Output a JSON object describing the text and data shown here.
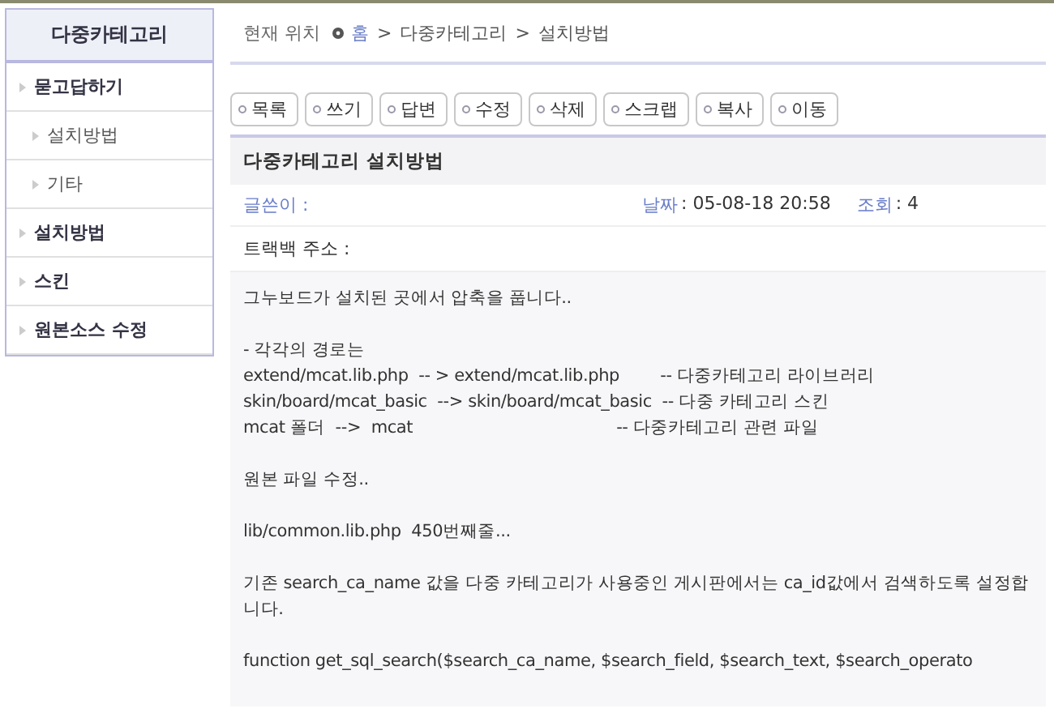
{
  "sidebar": {
    "title": "다중카테고리",
    "items": [
      {
        "label": "묻고답하기",
        "children": [
          {
            "label": "설치방법"
          },
          {
            "label": "기타"
          }
        ]
      },
      {
        "label": "설치방법"
      },
      {
        "label": "스킨"
      },
      {
        "label": "원본소스 수정"
      }
    ]
  },
  "breadcrumb": {
    "label": "현재 위치",
    "path": [
      "홈",
      "다중카테고리",
      "설치방법"
    ],
    "separators": [
      ">",
      ">"
    ]
  },
  "toolbar": [
    "목록",
    "쓰기",
    "답변",
    "수정",
    "삭제",
    "스크랩",
    "복사",
    "이동"
  ],
  "post": {
    "title": "다중카테고리 설치방법",
    "author_label": "글쓴이 :",
    "date_label": "날짜",
    "date": ": 05-08-18 20:58",
    "views_label": "조회",
    "views": ": 4",
    "trackback_label": "트랙백 주소 :",
    "paragraphs": [
      [
        "그누보드가 설치된 곳에서 압축을 풉니다.."
      ],
      [
        "- 각각의 경로는",
        "extend/mcat.lib.php  -- > extend/mcat.lib.php        -- 다중카테고리 라이브러리",
        "skin/board/mcat_basic  --> skin/board/mcat_basic  -- 다중 카테고리 스킨",
        "mcat 폴더  -->  mcat                                        -- 다중카테고리 관련 파일"
      ],
      [
        "원본 파일 수정.."
      ],
      [
        "lib/common.lib.php  450번째줄..."
      ],
      [
        "기존 search_ca_name 값을 다중 카테고리가 사용중인 게시판에서는 ca_id값에서 검색하도록 설정합니다."
      ],
      [
        "function get_sql_search($search_ca_name, $search_field, $search_text, $search_operato"
      ]
    ]
  }
}
